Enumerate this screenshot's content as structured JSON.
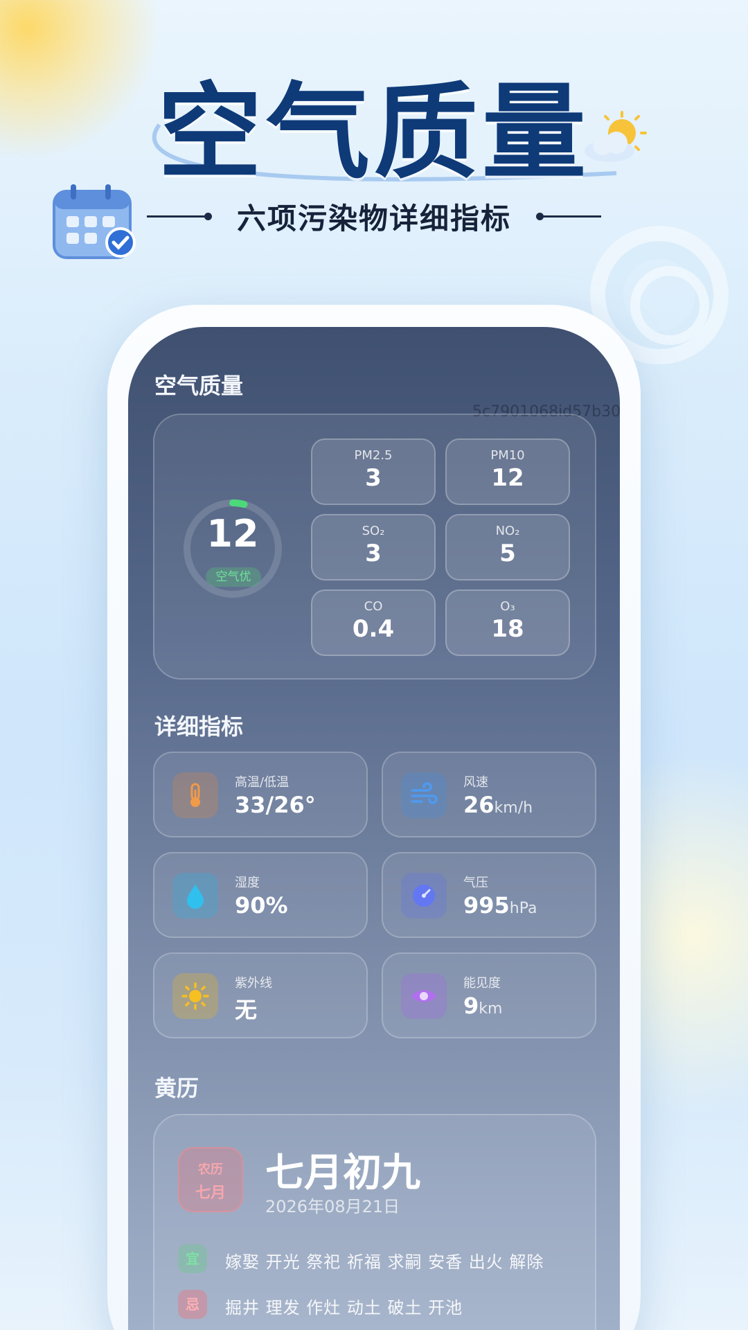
{
  "header": {
    "title": "空气质量",
    "subtitle": "六项污染物详细指标"
  },
  "screen": {
    "watermark": "5c7901068id57b30",
    "air_quality": {
      "section_title": "空气质量",
      "aqi_value": "12",
      "aqi_level": "空气优",
      "aqi_fraction": 0.04,
      "pollutants": [
        {
          "name": "PM2.5",
          "value": "3"
        },
        {
          "name": "PM10",
          "value": "12"
        },
        {
          "name": "SO₂",
          "value": "3"
        },
        {
          "name": "NO₂",
          "value": "5"
        },
        {
          "name": "CO",
          "value": "0.4"
        },
        {
          "name": "O₃",
          "value": "18"
        }
      ]
    },
    "details": {
      "section_title": "详细指标",
      "metrics": [
        {
          "label": "高温/低温",
          "value": "33/26°",
          "unit": "",
          "icon": "thermometer-icon",
          "color": "#e8883a"
        },
        {
          "label": "风速",
          "value": "26",
          "unit": "km/h",
          "icon": "wind-icon",
          "color": "#3f8fe8"
        },
        {
          "label": "湿度",
          "value": "90%",
          "unit": "",
          "icon": "water-drop-icon",
          "color": "#25b8e6"
        },
        {
          "label": "气压",
          "value": "995",
          "unit": "hPa",
          "icon": "pressure-gauge-icon",
          "color": "#5b6ef0"
        },
        {
          "label": "紫外线",
          "value": "无",
          "unit": "",
          "icon": "sun-icon",
          "color": "#f2b81e"
        },
        {
          "label": "能见度",
          "value": "9",
          "unit": "km",
          "icon": "eye-icon",
          "color": "#a565e8"
        }
      ]
    },
    "almanac": {
      "section_title": "黄历",
      "badge_top": "农历",
      "badge_bottom": "七月",
      "lunar_date": "七月初九",
      "solar_date": "2026年08月21日",
      "yi_tag": "宜",
      "yi_text": "嫁娶 开光 祭祀 祈福 求嗣 安香 出火 解除",
      "ji_tag": "忌",
      "ji_text": "掘井 理发 作灶 动土 破土 开池"
    }
  },
  "colors": {
    "title": "#0e3a78",
    "aqi_good": "#4cd97a"
  }
}
